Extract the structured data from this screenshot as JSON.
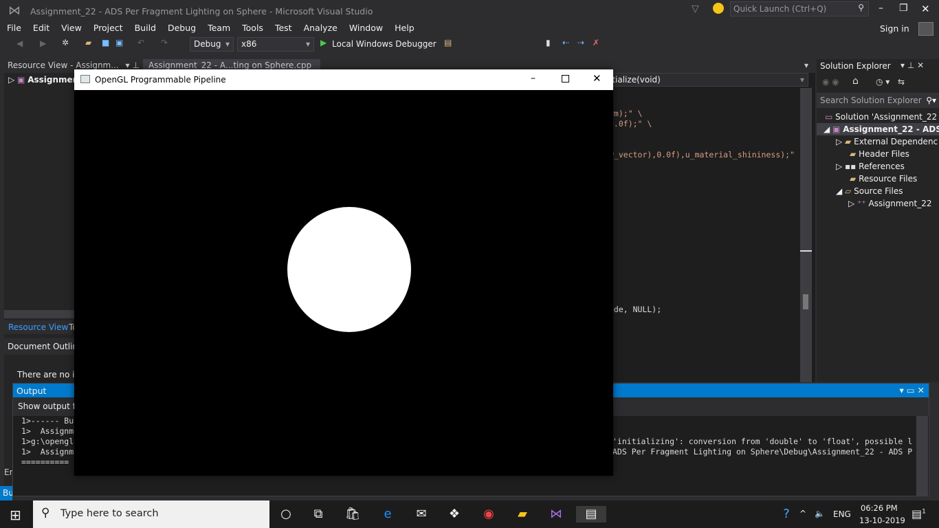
{
  "window": {
    "title": "Assignment_22 - ADS Per Fragment Lighting on Sphere - Microsoft Visual Studio",
    "quick_launch": "Quick Launch (Ctrl+Q)",
    "sign_in": "Sign in"
  },
  "menu": [
    "File",
    "Edit",
    "View",
    "Project",
    "Build",
    "Debug",
    "Team",
    "Tools",
    "Test",
    "Analyze",
    "Window",
    "Help"
  ],
  "toolbar": {
    "config": "Debug",
    "platform": "x86",
    "debugger": "Local Windows Debugger"
  },
  "tabs": {
    "resource_view": "Resource View - Assignm...",
    "editor_tab": "Assignment_22 - A...ting on Sphere.cpp",
    "solution_explorer": "Solution Explorer"
  },
  "editor": {
    "function_dropdown": "itialize(void)",
    "lines": [
      "rm);\" \\",
      "0.0f);\" \\",
      "w_vector),0.0f),u_material_shininess);\"",
      "ode, NULL);"
    ]
  },
  "left": {
    "tree_root": "Assignment",
    "tab_resource": "Resource View",
    "tab_toolbox": "To",
    "doc_outline": "Document Outline",
    "empty_text": "There are no ite",
    "error_tab": "Err",
    "build_status": "Bu"
  },
  "solution": {
    "search_placeholder": "Search Solution Explorer",
    "items": [
      "Solution 'Assignment_22 -",
      "Assignment_22 - ADS",
      "External Dependenc",
      "Header Files",
      "References",
      "Resource Files",
      "Source Files",
      "Assignment_22"
    ]
  },
  "output": {
    "title": "Output",
    "show_from": "Show output fro",
    "lines_left": [
      "1>------ Bu",
      "1>  Assignm",
      "1>g:\\opengl",
      "1>  Assignm",
      "=========="
    ],
    "lines_right": [
      "",
      "",
      "'initializing': conversion from 'double' to 'float', possible l",
      "ADS Per Fragment Lighting on Sphere\\Debug\\Assignment_22 - ADS P",
      ""
    ]
  },
  "opengl_window": {
    "title": "OpenGL Programmable Pipeline"
  },
  "taskbar": {
    "search_placeholder": "Type here to search",
    "language": "ENG",
    "time": "06:26 PM",
    "date": "13-10-2019",
    "notifications": "1"
  },
  "colors": {
    "accent": "#007acc",
    "sphere": "#ffffff"
  }
}
